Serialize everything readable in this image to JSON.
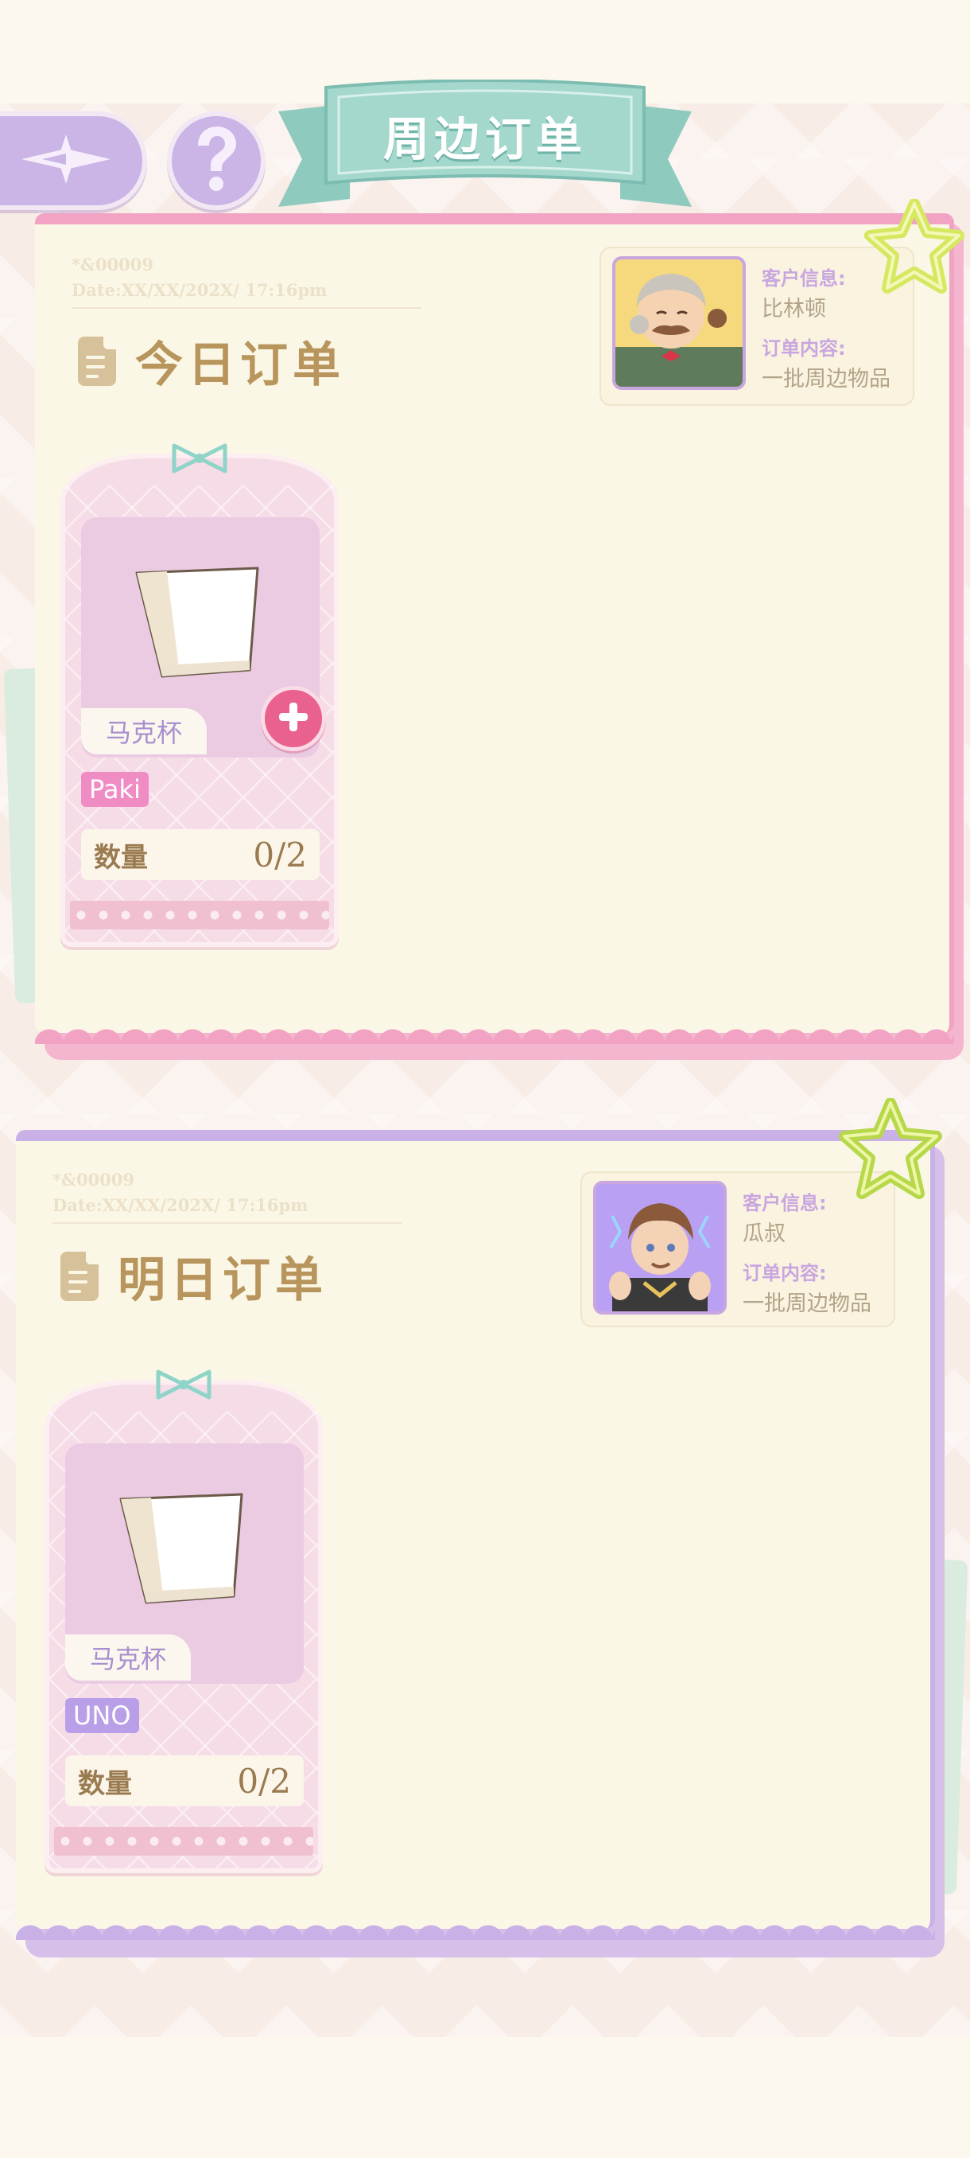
{
  "header": {
    "title": "周边订单",
    "back_icon": "back-arrow-icon",
    "help_icon": "question-mark-icon"
  },
  "orders": [
    {
      "serial": "*&00009",
      "date": "Date:XX/XX/202X/ 17:16pm",
      "title": "今日订单",
      "customer_label": "客户信息:",
      "customer_name": "比林顿",
      "content_label": "订单内容:",
      "content_value": "一批周边物品",
      "theme_color": "#f2a3c3",
      "item": {
        "name": "马克杯",
        "brand": "Paki",
        "brand_color": "#f08cc4",
        "quantity_label": "数量",
        "quantity": "0/2",
        "has_add_button": true
      }
    },
    {
      "serial": "*&00009",
      "date": "Date:XX/XX/202X/ 17:16pm",
      "title": "明日订单",
      "customer_label": "客户信息:",
      "customer_name": "瓜叔",
      "content_label": "订单内容:",
      "content_value": "一批周边物品",
      "theme_color": "#c9b0e6",
      "item": {
        "name": "马克杯",
        "brand": "UNO",
        "brand_color": "#b99ee8",
        "quantity_label": "数量",
        "quantity": "0/2",
        "has_add_button": false
      }
    }
  ]
}
